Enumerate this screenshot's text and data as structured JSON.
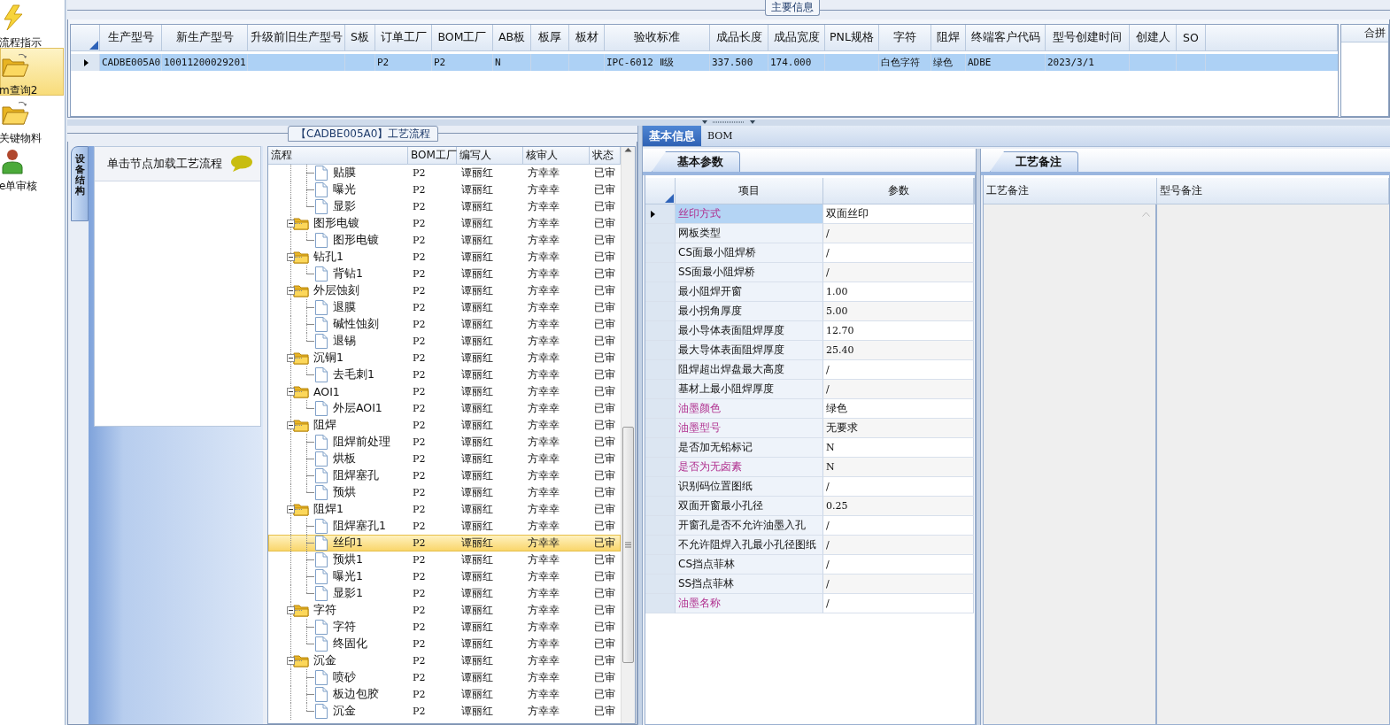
{
  "sidebar": {
    "items": [
      {
        "label": "流程指示",
        "kind": "bolt",
        "selected": false
      },
      {
        "label": "m查询2",
        "kind": "folder",
        "selected": true
      },
      {
        "label": "关键物料",
        "kind": "folder",
        "selected": false
      },
      {
        "label": "e单审核",
        "kind": "person",
        "selected": false
      }
    ]
  },
  "main_info": {
    "title": "主要信息",
    "columns": [
      "生产型号",
      "新生产型号",
      "升级前旧生产型号",
      "S板",
      "订单工厂",
      "BOM工厂",
      "AB板",
      "板厚",
      "板材",
      "验收标准",
      "成品长度",
      "成品宽度",
      "PNL规格",
      "字符",
      "阻焊",
      "终端客户代码",
      "型号创建时间",
      "创建人",
      "SO"
    ],
    "rows": [
      {
        "selected": true,
        "cells": [
          "CADBE005A0",
          "10011200029201",
          null,
          null,
          "P2",
          "P2",
          "N",
          null,
          null,
          "IPC-6012 Ⅱ级",
          "337.500",
          "174.000",
          null,
          "白色字符",
          "绿色",
          "ADBE",
          "2023/3/1",
          null,
          null
        ]
      }
    ],
    "side_column": "合拼"
  },
  "process": {
    "title": "【CADBE005A0】工艺流程",
    "side_tab": "设备结构",
    "hint": "单击节点加载工艺流程",
    "columns": [
      "流程",
      "BOM工厂",
      "编写人",
      "核审人",
      "状态"
    ],
    "tree": [
      {
        "children": [
          {
            "name": "贴膜",
            "bom_factory": "P2",
            "writer": "谭丽红",
            "reviewer": "方幸幸",
            "status": "已审",
            "selected": false
          },
          {
            "name": "曝光",
            "bom_factory": "P2",
            "writer": "谭丽红",
            "reviewer": "方幸幸",
            "status": "已审",
            "selected": false
          },
          {
            "name": "显影",
            "bom_factory": "P2",
            "writer": "谭丽红",
            "reviewer": "方幸幸",
            "status": "已审",
            "selected": false
          }
        ]
      },
      {
        "name": "图形电镀",
        "bom_factory": "P2",
        "writer": "谭丽红",
        "reviewer": "方幸幸",
        "status": "已审",
        "selected": false,
        "expanded": true,
        "children": [
          {
            "name": "图形电镀",
            "bom_factory": "P2",
            "writer": "谭丽红",
            "reviewer": "方幸幸",
            "status": "已审",
            "selected": false
          }
        ]
      },
      {
        "name": "钻孔1",
        "bom_factory": "P2",
        "writer": "谭丽红",
        "reviewer": "方幸幸",
        "status": "已审",
        "selected": false,
        "expanded": true,
        "children": [
          {
            "name": "背钻1",
            "bom_factory": "P2",
            "writer": "谭丽红",
            "reviewer": "方幸幸",
            "status": "已审",
            "selected": false
          }
        ]
      },
      {
        "name": "外层蚀刻",
        "bom_factory": "P2",
        "writer": "谭丽红",
        "reviewer": "方幸幸",
        "status": "已审",
        "selected": false,
        "expanded": true,
        "children": [
          {
            "name": "退膜",
            "bom_factory": "P2",
            "writer": "谭丽红",
            "reviewer": "方幸幸",
            "status": "已审",
            "selected": false
          },
          {
            "name": "碱性蚀刻",
            "bom_factory": "P2",
            "writer": "谭丽红",
            "reviewer": "方幸幸",
            "status": "已审",
            "selected": false
          },
          {
            "name": "退锡",
            "bom_factory": "P2",
            "writer": "谭丽红",
            "reviewer": "方幸幸",
            "status": "已审",
            "selected": false
          }
        ]
      },
      {
        "name": "沉铜1",
        "bom_factory": "P2",
        "writer": "谭丽红",
        "reviewer": "方幸幸",
        "status": "已审",
        "selected": false,
        "expanded": true,
        "children": [
          {
            "name": "去毛刺1",
            "bom_factory": "P2",
            "writer": "谭丽红",
            "reviewer": "方幸幸",
            "status": "已审",
            "selected": false
          }
        ]
      },
      {
        "name": "AOI1",
        "bom_factory": "P2",
        "writer": "谭丽红",
        "reviewer": "方幸幸",
        "status": "已审",
        "selected": false,
        "expanded": true,
        "children": [
          {
            "name": "外层AOI1",
            "bom_factory": "P2",
            "writer": "谭丽红",
            "reviewer": "方幸幸",
            "status": "已审",
            "selected": false
          }
        ]
      },
      {
        "name": "阻焊",
        "bom_factory": "P2",
        "writer": "谭丽红",
        "reviewer": "方幸幸",
        "status": "已审",
        "selected": false,
        "expanded": true,
        "children": [
          {
            "name": "阻焊前处理",
            "bom_factory": "P2",
            "writer": "谭丽红",
            "reviewer": "方幸幸",
            "status": "已审",
            "selected": false
          },
          {
            "name": "烘板",
            "bom_factory": "P2",
            "writer": "谭丽红",
            "reviewer": "方幸幸",
            "status": "已审",
            "selected": false
          },
          {
            "name": "阻焊塞孔",
            "bom_factory": "P2",
            "writer": "谭丽红",
            "reviewer": "方幸幸",
            "status": "已审",
            "selected": false
          },
          {
            "name": "预烘",
            "bom_factory": "P2",
            "writer": "谭丽红",
            "reviewer": "方幸幸",
            "status": "已审",
            "selected": false
          }
        ]
      },
      {
        "name": "阻焊1",
        "bom_factory": "P2",
        "writer": "谭丽红",
        "reviewer": "方幸幸",
        "status": "已审",
        "selected": false,
        "expanded": true,
        "children": [
          {
            "name": "阻焊塞孔1",
            "bom_factory": "P2",
            "writer": "谭丽红",
            "reviewer": "方幸幸",
            "status": "已审",
            "selected": false
          },
          {
            "name": "丝印1",
            "bom_factory": "P2",
            "writer": "谭丽红",
            "reviewer": "方幸幸",
            "status": "已审",
            "selected": true
          },
          {
            "name": "预烘1",
            "bom_factory": "P2",
            "writer": "谭丽红",
            "reviewer": "方幸幸",
            "status": "已审",
            "selected": false
          },
          {
            "name": "曝光1",
            "bom_factory": "P2",
            "writer": "谭丽红",
            "reviewer": "方幸幸",
            "status": "已审",
            "selected": false
          },
          {
            "name": "显影1",
            "bom_factory": "P2",
            "writer": "谭丽红",
            "reviewer": "方幸幸",
            "status": "已审",
            "selected": false
          }
        ]
      },
      {
        "name": "字符",
        "bom_factory": "P2",
        "writer": "谭丽红",
        "reviewer": "方幸幸",
        "status": "已审",
        "selected": false,
        "expanded": true,
        "children": [
          {
            "name": "字符",
            "bom_factory": "P2",
            "writer": "谭丽红",
            "reviewer": "方幸幸",
            "status": "已审",
            "selected": false
          },
          {
            "name": "终固化",
            "bom_factory": "P2",
            "writer": "谭丽红",
            "reviewer": "方幸幸",
            "status": "已审",
            "selected": false
          }
        ]
      },
      {
        "name": "沉金",
        "bom_factory": "P2",
        "writer": "谭丽红",
        "reviewer": "方幸幸",
        "status": "已审",
        "selected": false,
        "expanded": true,
        "children": [
          {
            "name": "喷砂",
            "bom_factory": "P2",
            "writer": "谭丽红",
            "reviewer": "方幸幸",
            "status": "已审",
            "selected": false
          },
          {
            "name": "板边包胶",
            "bom_factory": "P2",
            "writer": "谭丽红",
            "reviewer": "方幸幸",
            "status": "已审",
            "selected": false
          },
          {
            "name": "沉金",
            "bom_factory": "P2",
            "writer": "谭丽红",
            "reviewer": "方幸幸",
            "status": "已审",
            "selected": false
          }
        ]
      }
    ]
  },
  "detail": {
    "tabs": [
      {
        "label": "基本信息",
        "selected": true
      },
      {
        "label": "BOM",
        "selected": false
      }
    ],
    "params": {
      "tab": "基本参数",
      "columns": [
        "项目",
        "参数"
      ],
      "rows": [
        {
          "item": "丝印方式",
          "value": "双面丝印",
          "emphasized": true,
          "selected": true
        },
        {
          "item": "网板类型",
          "value": "/",
          "emphasized": false,
          "selected": false
        },
        {
          "item": "CS面最小阻焊桥",
          "value": "/",
          "emphasized": false,
          "selected": false
        },
        {
          "item": "SS面最小阻焊桥",
          "value": "/",
          "emphasized": false,
          "selected": false
        },
        {
          "item": "最小阻焊开窗",
          "value": "1.00",
          "emphasized": false,
          "selected": false
        },
        {
          "item": "最小拐角厚度",
          "value": "5.00",
          "emphasized": false,
          "selected": false
        },
        {
          "item": "最小导体表面阻焊厚度",
          "value": "12.70",
          "emphasized": false,
          "selected": false
        },
        {
          "item": "最大导体表面阻焊厚度",
          "value": "25.40",
          "emphasized": false,
          "selected": false
        },
        {
          "item": "阻焊超出焊盘最大高度",
          "value": "/",
          "emphasized": false,
          "selected": false
        },
        {
          "item": "基材上最小阻焊厚度",
          "value": "/",
          "emphasized": false,
          "selected": false
        },
        {
          "item": "油墨颜色",
          "value": "绿色",
          "emphasized": true,
          "selected": false
        },
        {
          "item": "油墨型号",
          "value": "无要求",
          "emphasized": true,
          "selected": false
        },
        {
          "item": "是否加无铅标记",
          "value": "N",
          "emphasized": false,
          "selected": false
        },
        {
          "item": "是否为无卤素",
          "value": "N",
          "emphasized": true,
          "selected": false
        },
        {
          "item": "识别码位置图纸",
          "value": "/",
          "emphasized": false,
          "selected": false
        },
        {
          "item": "双面开窗最小孔径",
          "value": "0.25",
          "emphasized": false,
          "selected": false
        },
        {
          "item": "开窗孔是否不允许油墨入孔",
          "value": "/",
          "emphasized": false,
          "selected": false
        },
        {
          "item": "不允许阻焊入孔最小孔径图纸",
          "value": "/",
          "emphasized": false,
          "selected": false
        },
        {
          "item": "CS挡点菲林",
          "value": "/",
          "emphasized": false,
          "selected": false
        },
        {
          "item": "SS挡点菲林",
          "value": "/",
          "emphasized": false,
          "selected": false
        },
        {
          "item": "油墨名称",
          "value": "/",
          "emphasized": true,
          "selected": false
        }
      ]
    },
    "notes": {
      "tab": "工艺备注",
      "columns": [
        "工艺备注",
        "型号备注"
      ]
    }
  }
}
